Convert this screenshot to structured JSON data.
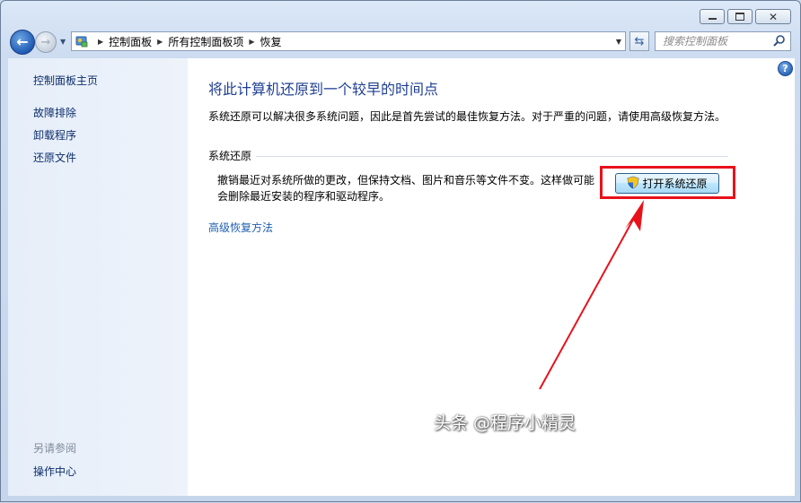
{
  "window": {
    "controls": {
      "minimize_icon": "minimize-icon",
      "maximize_icon": "maximize-icon",
      "close_icon": "close-icon"
    }
  },
  "nav": {
    "address": {
      "crumbs": [
        "控制面板",
        "所有控制面板项",
        "恢复"
      ]
    },
    "search": {
      "placeholder": "搜索控制面板"
    }
  },
  "sidebar": {
    "home": "控制面板主页",
    "links": [
      "故障排除",
      "卸载程序",
      "还原文件"
    ],
    "see_also_title": "另请参阅",
    "see_also_links": [
      "操作中心"
    ]
  },
  "main": {
    "title": "将此计算机还原到一个较早的时间点",
    "intro": "系统还原可以解决很多系统问题，因此是首先尝试的最佳恢复方法。对于严重的问题，请使用高级恢复方法。",
    "group_title": "系统还原",
    "description": "撤销最近对系统所做的更改，但保持文档、图片和音乐等文件不变。这样做可能会删除最近安装的程序和驱动程序。",
    "open_restore_button": "打开系统还原",
    "advanced_link": "高级恢复方法"
  },
  "annotation": {
    "color": "#e8121b"
  },
  "watermark": "头条 @程序小精灵",
  "colors": {
    "title_blue": "#1f3f93",
    "link_blue": "#1e5fb0",
    "sidebar_link": "#0d2e6c"
  }
}
